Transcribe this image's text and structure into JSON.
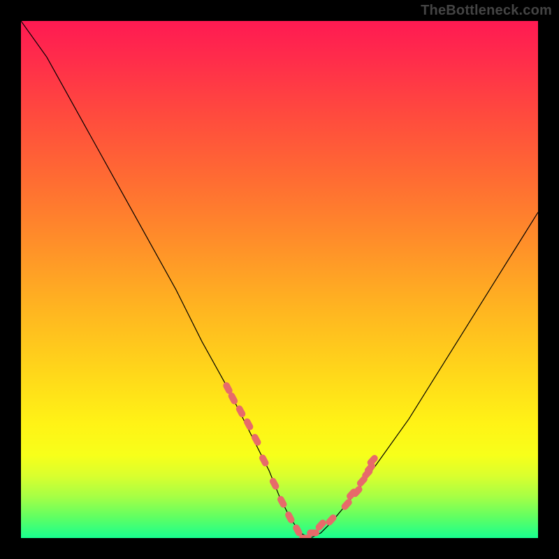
{
  "watermark": "TheBottleneck.com",
  "chart_data": {
    "type": "line",
    "title": "",
    "xlabel": "",
    "ylabel": "",
    "xlim": [
      0,
      100
    ],
    "ylim": [
      0,
      100
    ],
    "series": [
      {
        "name": "bottleneck_curve",
        "x": [
          0,
          5,
          10,
          15,
          20,
          25,
          30,
          35,
          40,
          45,
          48,
          50,
          52,
          54,
          56,
          58,
          60,
          65,
          70,
          75,
          80,
          85,
          90,
          95,
          100
        ],
        "y": [
          100,
          93,
          84,
          75,
          66,
          57,
          48,
          38,
          29,
          19,
          13,
          8,
          4,
          1,
          0,
          1,
          3,
          9,
          16,
          23,
          31,
          39,
          47,
          55,
          63
        ]
      }
    ],
    "markers": {
      "name": "highlight_points",
      "color": "#e76a6a",
      "x": [
        40,
        41,
        42.5,
        44,
        45.5,
        47,
        49,
        50.5,
        52,
        53.5,
        55,
        56.5,
        58,
        60,
        63,
        64,
        65,
        66,
        67,
        67.5,
        68
      ],
      "y": [
        29,
        27,
        24.5,
        22,
        19,
        15,
        10.5,
        7,
        4,
        1.5,
        0,
        1,
        2.5,
        3.5,
        6.5,
        8.5,
        9,
        11,
        12.5,
        13.5,
        15
      ]
    },
    "gradient_stops": [
      {
        "pos": 0.0,
        "color": "#ff1a52"
      },
      {
        "pos": 0.3,
        "color": "#ff6a33"
      },
      {
        "pos": 0.68,
        "color": "#ffd71a"
      },
      {
        "pos": 0.88,
        "color": "#d9ff2e"
      },
      {
        "pos": 1.0,
        "color": "#18ff8f"
      }
    ]
  }
}
